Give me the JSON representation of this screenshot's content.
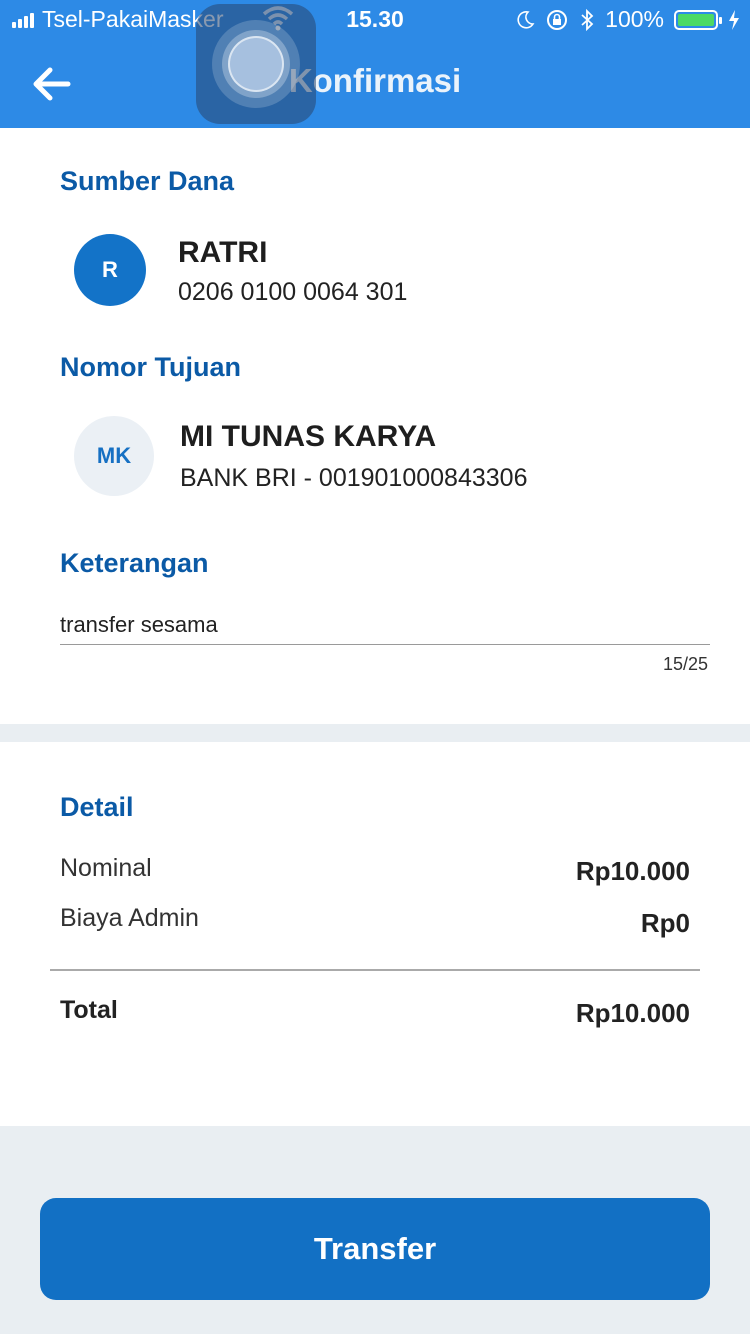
{
  "status_bar": {
    "carrier": "Tsel-PakaiMasker",
    "time": "15.30",
    "battery_percent": "100%",
    "battery_level": 1.0,
    "icons": [
      "signal-icon",
      "wifi-icon",
      "moon-icon",
      "rotation-lock-icon",
      "bluetooth-icon",
      "battery-icon",
      "charging-icon"
    ]
  },
  "header": {
    "title": "Konfirmasi",
    "back_icon": "arrow-left-icon",
    "color": "#2d8ae6"
  },
  "source": {
    "section_title": "Sumber Dana",
    "avatar_initials": "R",
    "name": "RATRI",
    "account": "0206 0100 0064 301"
  },
  "destination": {
    "section_title": "Nomor Tujuan",
    "avatar_initials": "MK",
    "name": "MI TUNAS KARYA",
    "bank_account": "BANK BRI - 001901000843306"
  },
  "note": {
    "section_title": "Keterangan",
    "value": "transfer sesama",
    "counter": "15/25"
  },
  "detail": {
    "section_title": "Detail",
    "rows": [
      {
        "label": "Nominal",
        "value": "Rp10.000"
      },
      {
        "label": "Biaya Admin",
        "value": "Rp0"
      }
    ],
    "total_label": "Total",
    "total_value": "Rp10.000"
  },
  "actions": {
    "transfer_label": "Transfer",
    "accent": "#1270c4"
  }
}
